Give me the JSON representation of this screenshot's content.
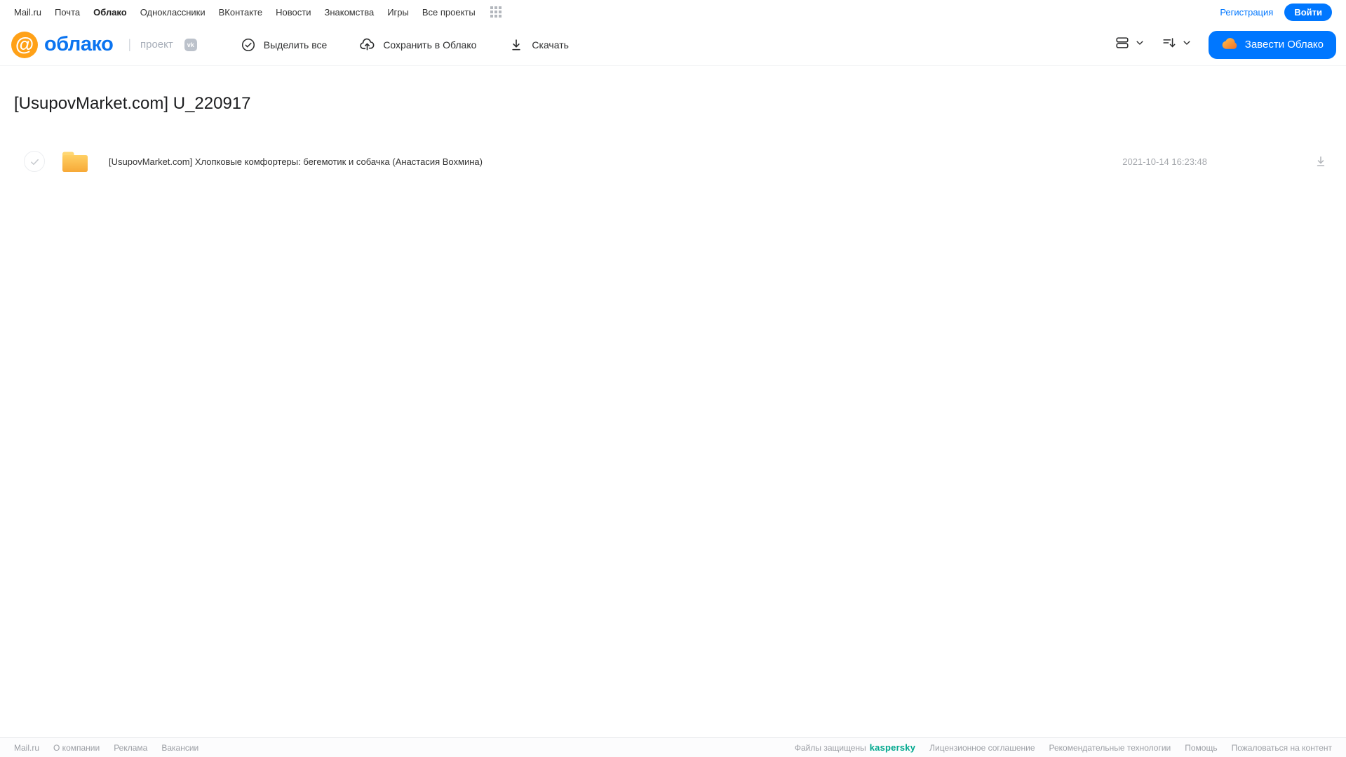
{
  "top_nav": {
    "links": [
      "Mail.ru",
      "Почта",
      "Облако",
      "Одноклассники",
      "ВКонтакте",
      "Новости",
      "Знакомства",
      "Игры",
      "Все проекты"
    ],
    "active_link": "Облако",
    "registration": "Регистрация",
    "login": "Войти"
  },
  "header": {
    "logo_at": "@",
    "logo": "облако",
    "project": "проект",
    "vk_badge": "vk",
    "toolbar": {
      "select_all": "Выделить все",
      "save_to_cloud": "Сохранить в Облако",
      "download": "Скачать"
    },
    "create_cloud": "Завести Облако"
  },
  "page": {
    "title": "[UsupovMarket.com] U_220917"
  },
  "files": [
    {
      "type": "folder",
      "name": "[UsupovMarket.com] Хлопковые комфортеры: бегемотик и собачка (Анастасия Вохмина)",
      "modified": "2021-10-14 16:23:48"
    }
  ],
  "footer": {
    "left_links": [
      "Mail.ru",
      "О компании",
      "Реклама",
      "Вакансии"
    ],
    "protected_by": "Файлы защищены",
    "kaspersky": "kaspersky",
    "right_links": [
      "Лицензионное соглашение",
      "Рекомендательные технологии",
      "Помощь",
      "Пожаловаться на контент"
    ]
  },
  "colors": {
    "accent_blue": "#0077ff",
    "logo_orange": "#ffa117",
    "logo_blue": "#0b74f0",
    "folder_top": "#ffd064",
    "folder_bottom": "#f7a937",
    "kaspersky_teal": "#00a88e"
  }
}
